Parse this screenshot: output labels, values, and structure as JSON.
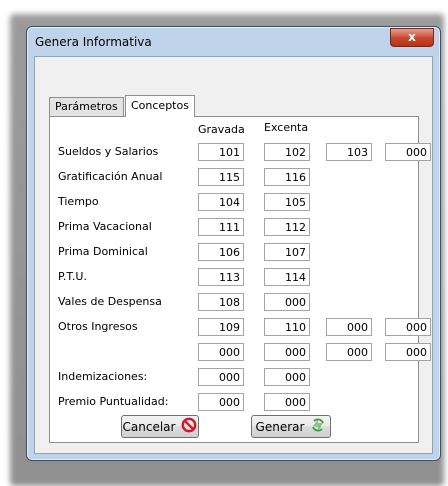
{
  "window": {
    "title": "Genera Informativa",
    "close_label": "x"
  },
  "tabs": [
    {
      "label": "Parámetros"
    },
    {
      "label": "Conceptos"
    }
  ],
  "columns": {
    "gravada": "Gravada",
    "excenta": "Excenta"
  },
  "rows": [
    {
      "label": "Sueldos y Salarios",
      "values": [
        "101",
        "102",
        "103",
        "000"
      ]
    },
    {
      "label": "Gratificación Anual",
      "values": [
        "115",
        "116"
      ]
    },
    {
      "label": "Tiempo",
      "values": [
        "104",
        "105"
      ]
    },
    {
      "label": "Prima Vacacional",
      "values": [
        "111",
        "112"
      ]
    },
    {
      "label": "Prima Dominical",
      "values": [
        "106",
        "107"
      ]
    },
    {
      "label": "P.T.U.",
      "values": [
        "113",
        "114"
      ]
    },
    {
      "label": "Vales de Despensa",
      "values": [
        "108",
        "000"
      ]
    },
    {
      "label": "Otros Ingresos",
      "values": [
        "109",
        "110",
        "000",
        "000"
      ]
    },
    {
      "label": "",
      "values": [
        "000",
        "000",
        "000",
        "000"
      ]
    },
    {
      "label": "Indemizaciones:",
      "values": [
        "000",
        "000"
      ]
    },
    {
      "label": "Premio Puntualidad:",
      "values": [
        "000",
        "000"
      ]
    }
  ],
  "buttons": {
    "cancel": "Cancelar",
    "generate": "Generar"
  },
  "colors": {
    "cancel_icon": "#d0182a",
    "generate_icon": "#3aa33a"
  }
}
